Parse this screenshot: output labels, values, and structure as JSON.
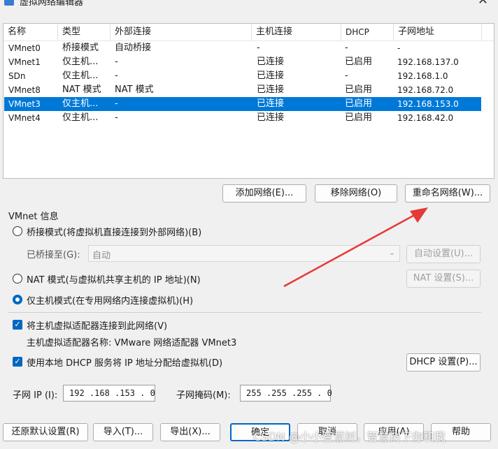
{
  "window": {
    "title": "虚拟网络编辑器",
    "close_glyph": "✕"
  },
  "table": {
    "headers": [
      "名称",
      "类型",
      "外部连接",
      "主机连接",
      "DHCP",
      "子网地址"
    ],
    "rows": [
      {
        "name": "VMnet0",
        "type": "桥接模式",
        "external": "自动桥接",
        "host": "-",
        "dhcp": "-",
        "subnet": "-"
      },
      {
        "name": "VMnet1",
        "type": "仅主机...",
        "external": "-",
        "host": "已连接",
        "dhcp": "已启用",
        "subnet": "192.168.137.0"
      },
      {
        "name": "SDn",
        "type": "仅主机...",
        "external": "-",
        "host": "已连接",
        "dhcp": "-",
        "subnet": "192.168.1.0"
      },
      {
        "name": "VMnet8",
        "type": "NAT 模式",
        "external": "NAT 模式",
        "host": "已连接",
        "dhcp": "已启用",
        "subnet": "192.168.72.0"
      },
      {
        "name": "VMnet3",
        "type": "仅主机...",
        "external": "-",
        "host": "已连接",
        "dhcp": "已启用",
        "subnet": "192.168.153.0",
        "selected": true
      },
      {
        "name": "VMnet4",
        "type": "仅主机...",
        "external": "-",
        "host": "已连接",
        "dhcp": "已启用",
        "subnet": "192.168.42.0"
      }
    ]
  },
  "buttons": {
    "add_network": "添加网络(E)...",
    "remove_network": "移除网络(O)",
    "rename_network": "重命名网络(W)..."
  },
  "vmnet_info": {
    "title": "VMnet 信息",
    "bridge_mode": "桥接模式(将虚拟机直接连接到外部网络)(B)",
    "bridged_to_label": "已桥接至(G):",
    "bridged_to_value": "自动",
    "auto_settings": "自动设置(U)...",
    "nat_mode": "NAT 模式(与虚拟机共享主机的 IP 地址)(N)",
    "nat_settings": "NAT 设置(S)...",
    "host_only_mode": "仅主机模式(在专用网络内连接虚拟机)(H)",
    "selected_mode": "host_only",
    "connect_adapter": "将主机虚拟适配器连接到此网络(V)",
    "connect_adapter_checked": true,
    "adapter_name": "主机虚拟适配器名称: VMware 网络适配器 VMnet3",
    "use_dhcp": "使用本地 DHCP 服务将 IP 地址分配给虚拟机(D)",
    "use_dhcp_checked": true,
    "dhcp_settings": "DHCP 设置(P)...",
    "subnet_ip_label": "子网 IP (I):",
    "subnet_ip": "192 .168 .153 . 0",
    "subnet_mask_label": "子网掩码(M):",
    "subnet_mask": "255 .255 .255 . 0"
  },
  "footer": {
    "restore_defaults": "还原默认设置(R)",
    "import": "导入(T)...",
    "export": "导出(X)...",
    "ok": "确定",
    "cancel": "取消",
    "apply": "应用(A)",
    "help": "帮助"
  },
  "watermark": "CSDN @小小智慧树，智慧树下你和我",
  "colors": {
    "selection": "#0078d7",
    "annotation_arrow": "#e53935",
    "checkbox": "#0067c0"
  }
}
